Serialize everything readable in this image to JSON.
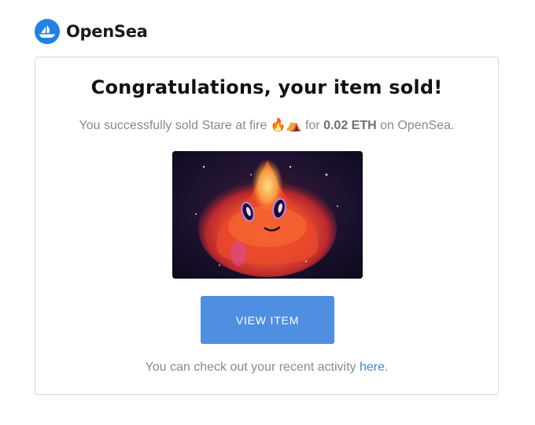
{
  "brand": {
    "name": "OpenSea",
    "logo_icon": "opensea-sailboat-icon",
    "color": "#2081e2"
  },
  "email": {
    "headline": "Congratulations, your item sold!",
    "sold_prefix": "You successfully sold ",
    "item_name": "Stare at fire",
    "item_emojis": "🔥⛺",
    "sold_middle": " for ",
    "price": "0.02 ETH",
    "sold_suffix": " on OpenSea.",
    "image_icon": "nft-fire-creature-image",
    "button_label": "VIEW ITEM",
    "button_color": "#4f8fe2",
    "footer_prefix": "You can check out your recent activity ",
    "footer_link": "here",
    "footer_suffix": ".",
    "link_color": "#3d86d9"
  }
}
